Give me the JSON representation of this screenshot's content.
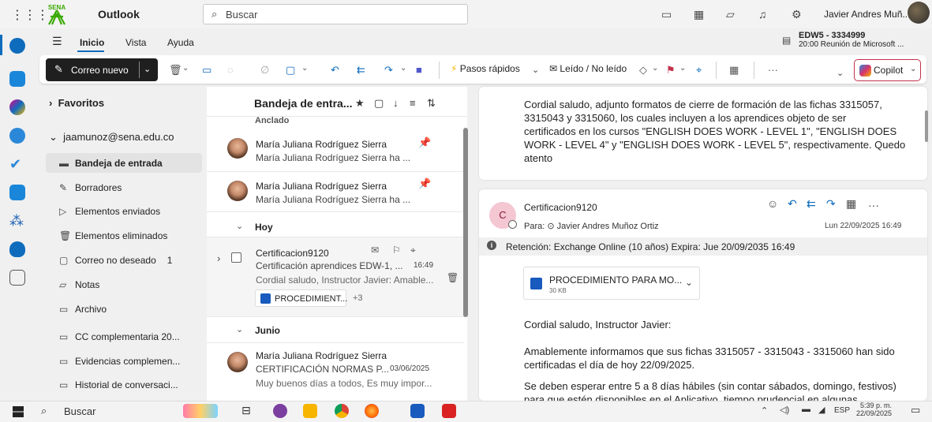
{
  "titlebar": {
    "app_title": "Outlook",
    "search_placeholder": "Buscar",
    "user_name": "Javier Andres Muñ...",
    "sena_label": "SENA"
  },
  "ribbon": {
    "tabs": [
      "Inicio",
      "Vista",
      "Ayuda"
    ],
    "meeting_title": "EDW5 - 3334999",
    "meeting_detail": "20:00 Reunión de Microsoft ...",
    "new_mail": "Correo nuevo",
    "quick_steps": "Pasos rápidos",
    "read_unread": "Leído / No leído",
    "more": "···",
    "copilot": "Copilot"
  },
  "folders": {
    "favorites": "Favoritos",
    "account": "jaamunoz@sena.edu.co",
    "items": [
      {
        "label": "Bandeja de entrada",
        "icon": "inbox-icon",
        "count": ""
      },
      {
        "label": "Borradores",
        "icon": "pencil-icon",
        "count": ""
      },
      {
        "label": "Elementos enviados",
        "icon": "send-icon",
        "count": ""
      },
      {
        "label": "Elementos eliminados",
        "icon": "trash-icon",
        "count": ""
      },
      {
        "label": "Correo no deseado",
        "icon": "junk-icon",
        "count": "1"
      },
      {
        "label": "Notas",
        "icon": "note-icon",
        "count": ""
      },
      {
        "label": "Archivo",
        "icon": "archive-icon",
        "count": ""
      },
      {
        "label": "CC complementaria 20...",
        "icon": "folder-icon",
        "count": ""
      },
      {
        "label": "Evidencias complemen...",
        "icon": "folder-icon",
        "count": ""
      },
      {
        "label": "Historial de conversaci...",
        "icon": "folder-icon",
        "count": ""
      }
    ]
  },
  "list": {
    "title": "Bandeja de entra...",
    "pinned_group": "Anclado",
    "pinned": [
      {
        "sender": "María Juliana Rodríguez Sierra",
        "preview": "María Juliana Rodríguez Sierra ha ..."
      },
      {
        "sender": "María Juliana Rodríguez Sierra",
        "preview": "María Juliana Rodríguez Sierra ha ..."
      }
    ],
    "group_today": "Hoy",
    "today_msg": {
      "sender": "Certificacion9120",
      "subject": "Certificación aprendices EDW-1, ...",
      "time": "16:49",
      "preview": "Cordial saludo, Instructor Javier: Amable...",
      "attachment": "PROCEDIMIENT...",
      "more_attachments": "+3"
    },
    "group_june": "Junio",
    "june_msg": {
      "sender": "María Juliana Rodríguez Sierra",
      "subject": "CERTIFICACIÓN NORMAS P...",
      "date": "03/06/2025",
      "preview": "Muy buenos días a todos, Es muy impor..."
    }
  },
  "reading": {
    "prev_body": [
      "Cordial saludo, adjunto formatos de cierre de formación de las fichas 3315057,",
      "3315043 y 3315060, los cuales incluyen a los aprendices objeto de ser",
      "certificados en los cursos \"ENGLISH DOES WORK - LEVEL 1\", \"ENGLISH DOES",
      "WORK - LEVEL 4\" y \"ENGLISH DOES WORK - LEVEL 5\", respectivamente. Quedo",
      "atento"
    ],
    "sender": "Certificacion9120",
    "sender_initial": "C",
    "to_label": "Para:",
    "to": "Javier Andres Muñoz Ortiz",
    "date": "Lun 22/09/2025 16:49",
    "retention": "Retención: Exchange Online (10 años) Expira: Jue 20/09/2035 16:49",
    "attachment_name": "PROCEDIMIENTO PARA MO...",
    "attachment_size": "30 KB",
    "body": [
      "Cordial saludo, Instructor Javier:",
      "Amablemente informamos que sus fichas 3315057 - 3315043 - 3315060 han sido",
      "certificadas el día de hoy 22/09/2025.",
      "Se deben esperar entre 5 a 8 días hábiles (sin contar sábados, domingo, festivos)",
      "para que estén disponibles en el Aplicativo, tiempo prudencial en algunas"
    ]
  },
  "taskbar": {
    "search": "Buscar",
    "lang": "ESP",
    "time": "5:39 p. m.",
    "date": "22/09/2025"
  }
}
